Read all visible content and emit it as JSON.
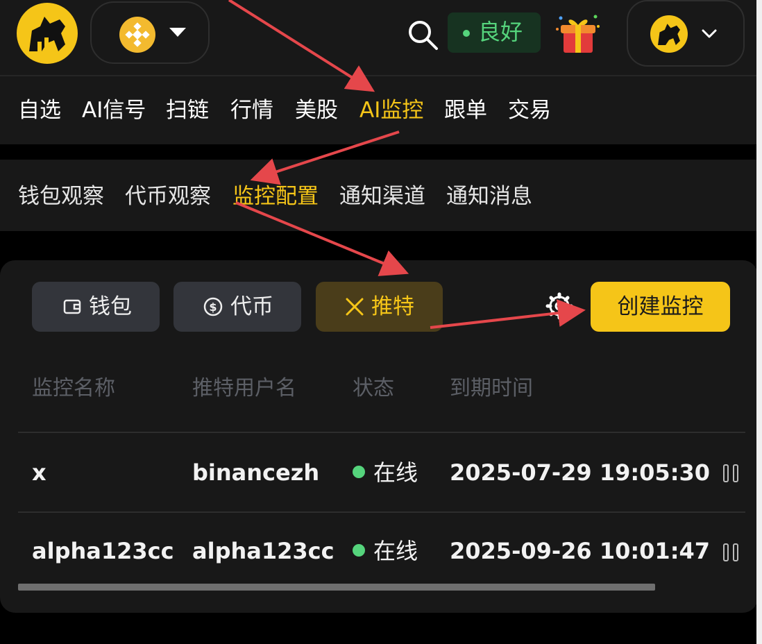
{
  "header": {
    "logo_icon": "dog-mascot-logo",
    "chain_icon": "bnb-chain-icon",
    "status_label": "良好",
    "status_color": "#55D47C",
    "accent_color": "#F5C518"
  },
  "main_nav": {
    "items": [
      "自选",
      "AI信号",
      "扫链",
      "行情",
      "美股",
      "AI监控",
      "跟单",
      "交易"
    ],
    "active": "AI监控"
  },
  "sub_nav": {
    "items": [
      "钱包观察",
      "代币观察",
      "监控配置",
      "通知渠道",
      "通知消息"
    ],
    "active": "监控配置"
  },
  "filters": {
    "wallet_label": "钱包",
    "token_label": "代币",
    "twitter_label": "推特",
    "active": "推特"
  },
  "create_button_label": "创建监控",
  "table": {
    "columns": [
      "监控名称",
      "推特用户名",
      "状态",
      "到期时间"
    ],
    "rows": [
      {
        "name": "x",
        "username": "binancezh",
        "status": "在线",
        "expires": "2025-07-29 19:05:30"
      },
      {
        "name": "alpha123cc",
        "username": "alpha123cc",
        "status": "在线",
        "expires": "2025-09-26 10:01:47"
      }
    ]
  },
  "annotation_color": "#E5474B"
}
